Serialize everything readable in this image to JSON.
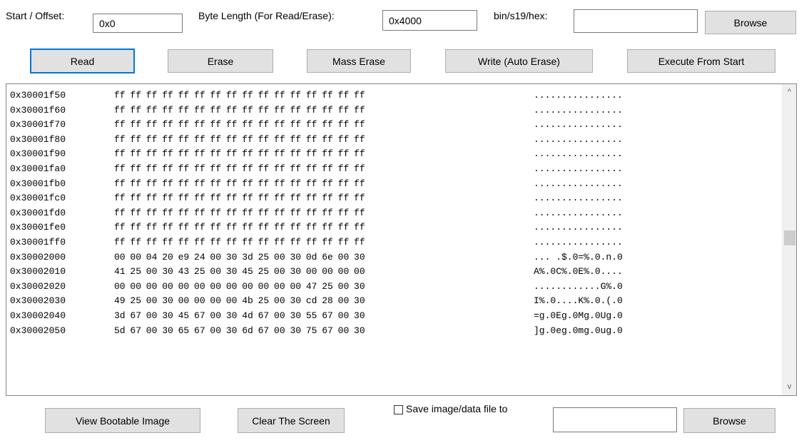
{
  "top_bar": {
    "start_offset_label": "Start / Offset:",
    "start_offset_value": "0x0",
    "byte_length_label": "Byte Length (For Read/Erase):",
    "byte_length_value": "0x4000",
    "file_label": "bin/s19/hex:",
    "file_value": "",
    "browse_label": "Browse"
  },
  "actions": {
    "read": "Read",
    "erase": "Erase",
    "mass_erase": "Mass Erase",
    "write": "Write (Auto Erase)",
    "execute": "Execute From Start"
  },
  "dump": {
    "rows": [
      {
        "addr": "0x30001f50",
        "hex": "ff ff ff ff ff ff ff ff ff ff ff ff ff ff ff ff",
        "ascii": "................"
      },
      {
        "addr": "0x30001f60",
        "hex": "ff ff ff ff ff ff ff ff ff ff ff ff ff ff ff ff",
        "ascii": "................"
      },
      {
        "addr": "0x30001f70",
        "hex": "ff ff ff ff ff ff ff ff ff ff ff ff ff ff ff ff",
        "ascii": "................"
      },
      {
        "addr": "0x30001f80",
        "hex": "ff ff ff ff ff ff ff ff ff ff ff ff ff ff ff ff",
        "ascii": "................"
      },
      {
        "addr": "0x30001f90",
        "hex": "ff ff ff ff ff ff ff ff ff ff ff ff ff ff ff ff",
        "ascii": "................"
      },
      {
        "addr": "0x30001fa0",
        "hex": "ff ff ff ff ff ff ff ff ff ff ff ff ff ff ff ff",
        "ascii": "................"
      },
      {
        "addr": "0x30001fb0",
        "hex": "ff ff ff ff ff ff ff ff ff ff ff ff ff ff ff ff",
        "ascii": "................"
      },
      {
        "addr": "0x30001fc0",
        "hex": "ff ff ff ff ff ff ff ff ff ff ff ff ff ff ff ff",
        "ascii": "................"
      },
      {
        "addr": "0x30001fd0",
        "hex": "ff ff ff ff ff ff ff ff ff ff ff ff ff ff ff ff",
        "ascii": "................"
      },
      {
        "addr": "0x30001fe0",
        "hex": "ff ff ff ff ff ff ff ff ff ff ff ff ff ff ff ff",
        "ascii": "................"
      },
      {
        "addr": "0x30001ff0",
        "hex": "ff ff ff ff ff ff ff ff ff ff ff ff ff ff ff ff",
        "ascii": "................"
      },
      {
        "addr": "0x30002000",
        "hex": "00 00 04 20 e9 24 00 30 3d 25 00 30 0d 6e 00 30",
        "ascii": "... .$.0=%.0.n.0"
      },
      {
        "addr": "0x30002010",
        "hex": "41 25 00 30 43 25 00 30 45 25 00 30 00 00 00 00",
        "ascii": "A%.0C%.0E%.0...."
      },
      {
        "addr": "0x30002020",
        "hex": "00 00 00 00 00 00 00 00 00 00 00 00 47 25 00 30",
        "ascii": "............G%.0"
      },
      {
        "addr": "0x30002030",
        "hex": "49 25 00 30 00 00 00 00 4b 25 00 30 cd 28 00 30",
        "ascii": "I%.0....K%.0.(.0"
      },
      {
        "addr": "0x30002040",
        "hex": "3d 67 00 30 45 67 00 30 4d 67 00 30 55 67 00 30",
        "ascii": "=g.0Eg.0Mg.0Ug.0"
      },
      {
        "addr": "0x30002050",
        "hex": "5d 67 00 30 65 67 00 30 6d 67 00 30 75 67 00 30",
        "ascii": "]g.0eg.0mg.0ug.0"
      }
    ]
  },
  "bottom_bar": {
    "view_bootable": "View Bootable Image",
    "clear_screen": "Clear The Screen",
    "save_label": "Save image/data file to",
    "save_checked": false,
    "save_path": "",
    "browse_label": "Browse"
  },
  "icons": {
    "scroll_up": "^",
    "scroll_down": "v"
  }
}
